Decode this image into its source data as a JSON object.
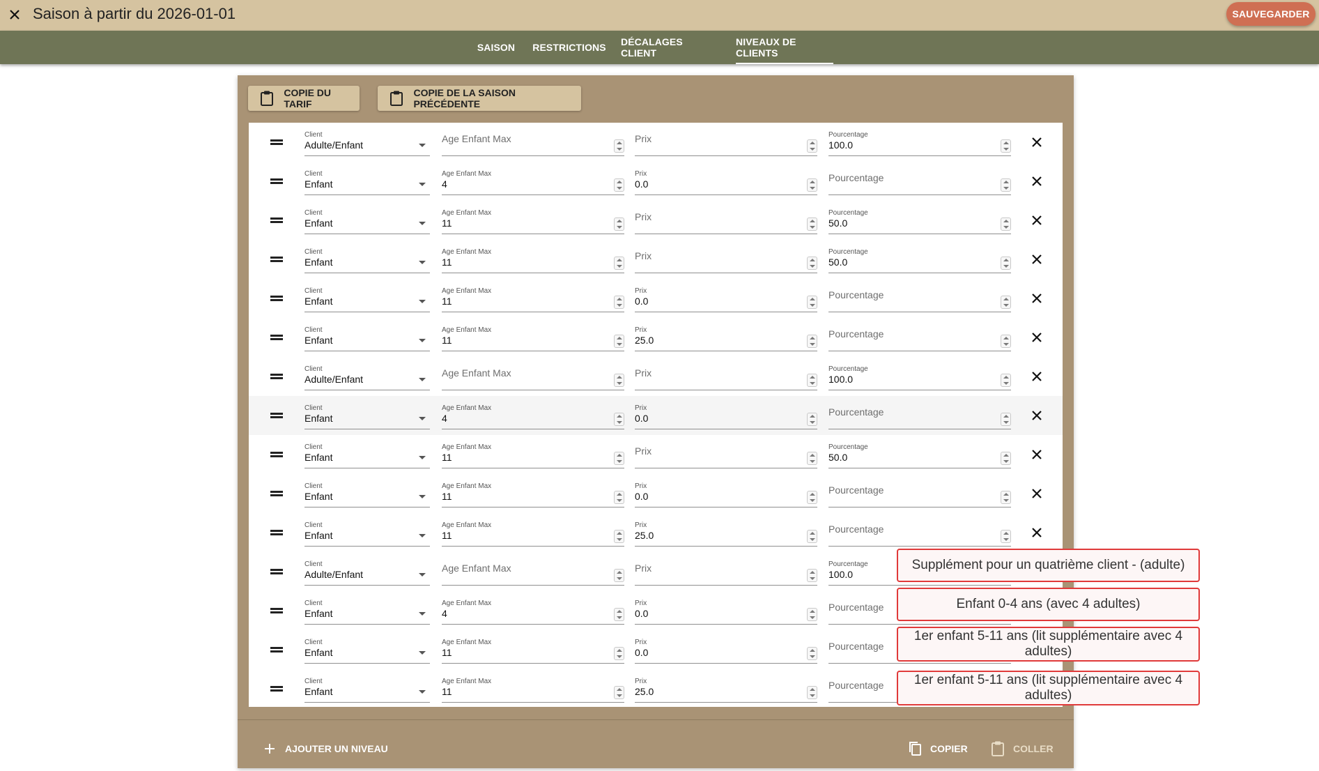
{
  "header": {
    "title": "Saison à partir du 2026-01-01",
    "save_label": "SAUVEGARDER"
  },
  "tabs": [
    {
      "label": "SAISON",
      "active": false
    },
    {
      "label": "RESTRICTIONS",
      "active": false
    },
    {
      "label": "DÉCALAGES CLIENT",
      "active": false
    },
    {
      "label": "NIVEAUX DE CLIENTS",
      "active": true
    }
  ],
  "toolbar": {
    "copy_tariff_label": "COPIE DU TARIF",
    "copy_previous_label": "COPIE DE LA SAISON PRÉCÉDENTE"
  },
  "field_labels": {
    "client": "Client",
    "age": "Age Enfant Max",
    "prix": "Prix",
    "pct": "Pourcentage"
  },
  "levels": [
    {
      "client": "Adulte/Enfant",
      "age": "",
      "prix": "",
      "pct": "100.0"
    },
    {
      "client": "Enfant",
      "age": "4",
      "prix": "0.0",
      "pct": ""
    },
    {
      "client": "Enfant",
      "age": "11",
      "prix": "",
      "pct": "50.0"
    },
    {
      "client": "Enfant",
      "age": "11",
      "prix": "",
      "pct": "50.0"
    },
    {
      "client": "Enfant",
      "age": "11",
      "prix": "0.0",
      "pct": ""
    },
    {
      "client": "Enfant",
      "age": "11",
      "prix": "25.0",
      "pct": ""
    },
    {
      "client": "Adulte/Enfant",
      "age": "",
      "prix": "",
      "pct": "100.0"
    },
    {
      "client": "Enfant",
      "age": "4",
      "prix": "0.0",
      "pct": ""
    },
    {
      "client": "Enfant",
      "age": "11",
      "prix": "",
      "pct": "50.0"
    },
    {
      "client": "Enfant",
      "age": "11",
      "prix": "0.0",
      "pct": ""
    },
    {
      "client": "Enfant",
      "age": "11",
      "prix": "25.0",
      "pct": ""
    },
    {
      "client": "Adulte/Enfant",
      "age": "",
      "prix": "",
      "pct": "100.0"
    },
    {
      "client": "Enfant",
      "age": "4",
      "prix": "0.0",
      "pct": ""
    },
    {
      "client": "Enfant",
      "age": "11",
      "prix": "0.0",
      "pct": ""
    },
    {
      "client": "Enfant",
      "age": "11",
      "prix": "25.0",
      "pct": ""
    }
  ],
  "footer": {
    "add_label": "AJOUTER UN NIVEAU",
    "copy_label": "COPIER",
    "paste_label": "COLLER"
  },
  "annotations": [
    "Supplément pour un quatrième client - (adulte)",
    "Enfant 0-4 ans (avec 4 adultes)",
    "1er enfant 5-11 ans (lit supplémentaire avec 4 adultes)",
    "1er enfant 5-11 ans (lit supplémentaire avec 4 adultes)"
  ],
  "colors": {
    "header_bg": "#d5c3a0",
    "tabbar_bg": "#6f7556",
    "card_bg": "#a99375",
    "save_button": "#cf6f53",
    "annotation_border": "#e03a3a"
  }
}
